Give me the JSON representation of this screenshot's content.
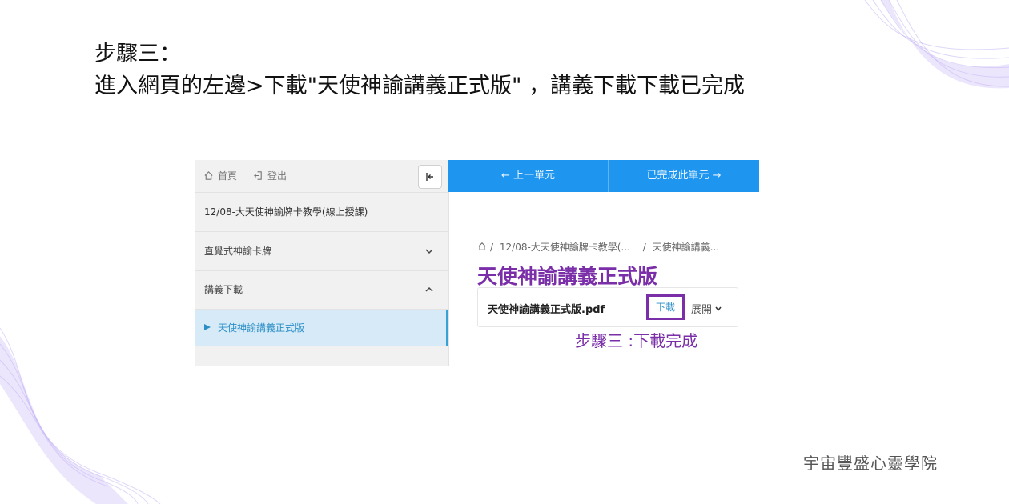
{
  "heading": {
    "line1": "步驟三：",
    "line2": "進入網頁的左邊>下載\"天使神諭講義正式版\" ，講義下載下載已完成"
  },
  "sidebar": {
    "home_label": "首頁",
    "logout_label": "登出",
    "course_title": "12/08-大天使神諭牌卡教學(線上授課)",
    "sections": [
      {
        "label": "直覺式神諭卡牌",
        "state": "collapsed"
      },
      {
        "label": "講義下載",
        "state": "expanded"
      }
    ],
    "active_item": "天使神諭講義正式版"
  },
  "navbar": {
    "prev_label": "← 上一單元",
    "next_label": "已完成此單元 →",
    "color": "#1e96f0"
  },
  "content": {
    "breadcrumb": [
      "12/08-大天使神諭牌卡教學(...",
      "天使神諭講義..."
    ],
    "title": "天使神諭講義正式版",
    "file_name": "天使神諭講義正式版.pdf",
    "download_label": "下載",
    "expand_label": "展開",
    "annotation": "步驟三 :下載完成",
    "highlight_color": "#7a2ea8"
  },
  "brand": "宇宙豐盛心靈學院",
  "icons": [
    "home-icon",
    "logout-icon",
    "collapse-sidebar-icon",
    "chevron-down-icon",
    "chevron-up-icon",
    "play-icon"
  ]
}
